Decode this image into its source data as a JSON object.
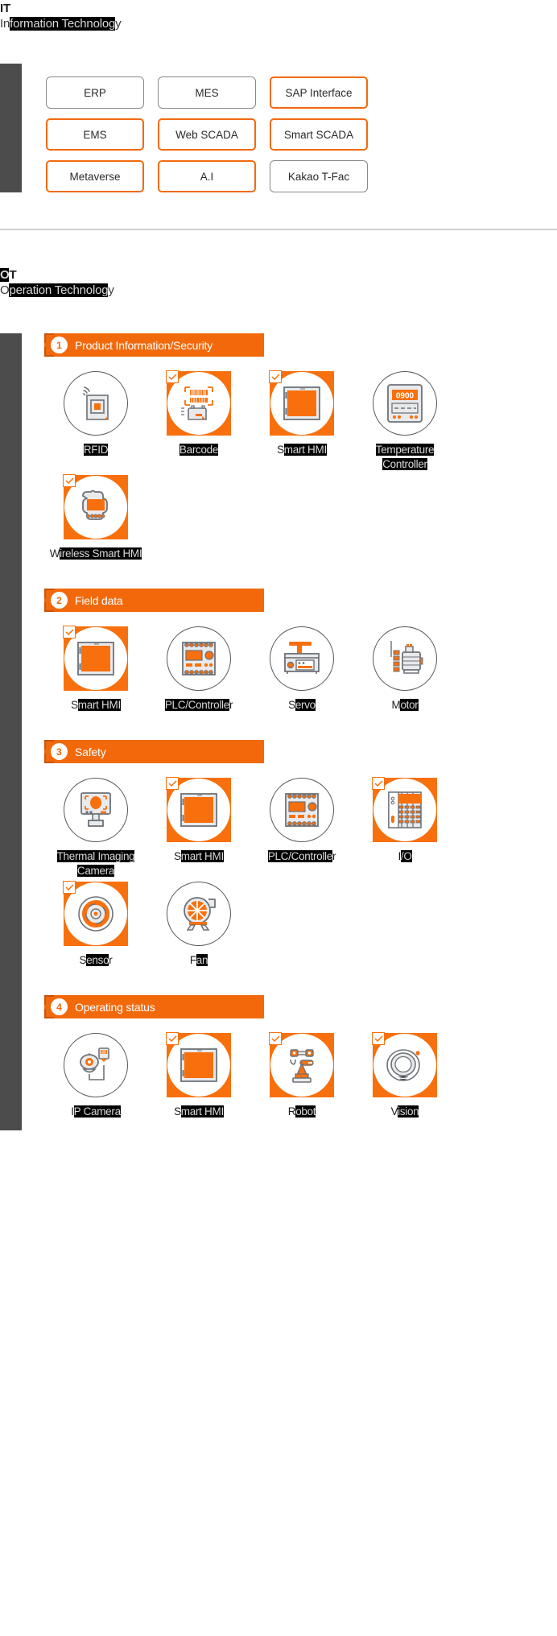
{
  "accent": "#f2690c",
  "it": {
    "abbr": "IT",
    "subtitle": "Information Technology",
    "subtitle_selected_part": "formation Technolog",
    "chips": [
      {
        "label": "ERP",
        "highlighted": false
      },
      {
        "label": "MES",
        "highlighted": false
      },
      {
        "label": "SAP Interface",
        "highlighted": true
      },
      {
        "label": "EMS",
        "highlighted": true
      },
      {
        "label": "Web SCADA",
        "highlighted": true
      },
      {
        "label": "Smart SCADA",
        "highlighted": true
      },
      {
        "label": "Metaverse",
        "highlighted": true
      },
      {
        "label": "A.I",
        "highlighted": true
      },
      {
        "label": "Kakao T-Fac",
        "highlighted": false
      }
    ]
  },
  "ot": {
    "abbr": "OT",
    "subtitle": "Operation Technology",
    "categories": [
      {
        "number": "1",
        "title": "Product Information/Security",
        "items": [
          {
            "label": "RFID",
            "icon": "rfid-icon",
            "checked": false
          },
          {
            "label": "Barcode",
            "icon": "barcode-scanner-icon",
            "checked": true
          },
          {
            "label": "Smart HMI",
            "icon": "smart-hmi-icon",
            "checked": true
          },
          {
            "label": "Temperature Controller",
            "icon": "temperature-controller-icon",
            "checked": false,
            "display": "0900"
          },
          {
            "label": "Wireless Smart HMI",
            "icon": "wireless-smart-hmi-icon",
            "checked": true
          }
        ]
      },
      {
        "number": "2",
        "title": "Field data",
        "items": [
          {
            "label": "Smart HMI",
            "icon": "smart-hmi-icon",
            "checked": true
          },
          {
            "label": "PLC/Controller",
            "icon": "plc-controller-icon",
            "checked": false
          },
          {
            "label": "Servo",
            "icon": "servo-icon",
            "checked": false
          },
          {
            "label": "Motor",
            "icon": "motor-icon",
            "checked": false
          }
        ]
      },
      {
        "number": "3",
        "title": "Safety",
        "items": [
          {
            "label": "Thermal Imaging Camera",
            "icon": "thermal-camera-icon",
            "checked": false
          },
          {
            "label": "Smart HMI",
            "icon": "smart-hmi-icon",
            "checked": true
          },
          {
            "label": "PLC/Controller",
            "icon": "plc-controller-icon",
            "checked": false
          },
          {
            "label": "I/O",
            "icon": "io-module-icon",
            "checked": true
          },
          {
            "label": "Sensor",
            "icon": "sensor-icon",
            "checked": true
          },
          {
            "label": "Fan",
            "icon": "fan-icon",
            "checked": false
          }
        ]
      },
      {
        "number": "4",
        "title": "Operating status",
        "items": [
          {
            "label": "IP Camera",
            "icon": "ip-camera-icon",
            "checked": false
          },
          {
            "label": "Smart HMI",
            "icon": "smart-hmi-icon",
            "checked": true
          },
          {
            "label": "Robot",
            "icon": "robot-arm-icon",
            "checked": true
          },
          {
            "label": "Vision",
            "icon": "vision-sensor-icon",
            "checked": true
          }
        ]
      }
    ]
  }
}
